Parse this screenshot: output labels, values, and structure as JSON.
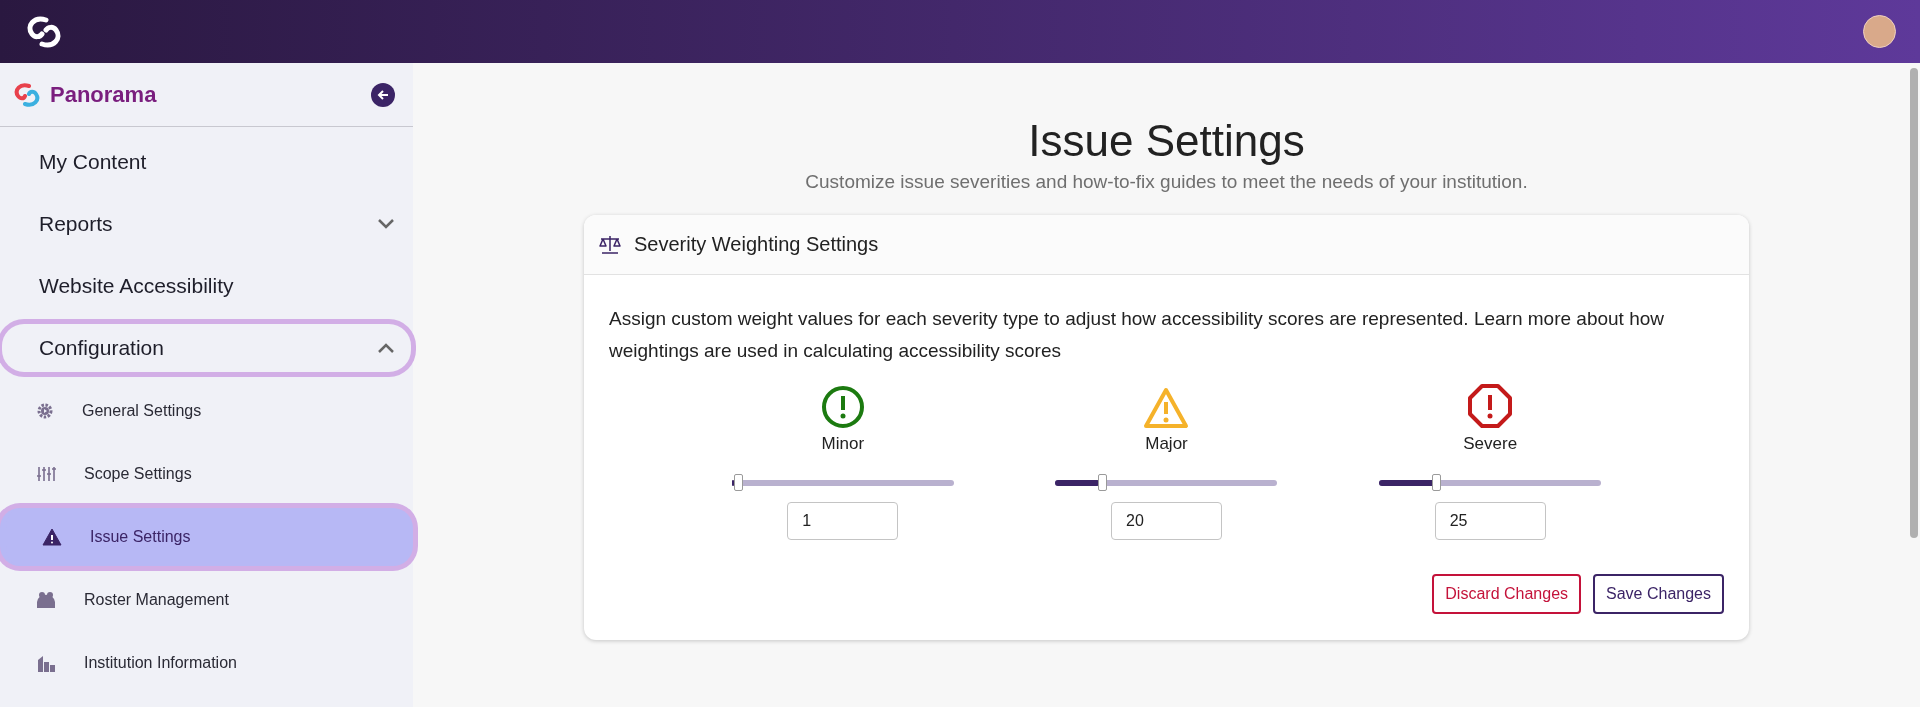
{
  "app": {
    "name": "Panorama"
  },
  "sidebar": {
    "items": [
      {
        "label": "My Content",
        "focused": false
      },
      {
        "label": "Reports",
        "expanded": false,
        "focused": false
      },
      {
        "label": "Website Accessibility",
        "focused": false
      },
      {
        "label": "Configuration",
        "expanded": true,
        "focused": true,
        "children": [
          {
            "label": "General Settings",
            "selected": false
          },
          {
            "label": "Scope Settings",
            "selected": false
          },
          {
            "label": "Issue Settings",
            "selected": true
          },
          {
            "label": "Roster Management",
            "selected": false
          },
          {
            "label": "Institution Information",
            "selected": false
          }
        ]
      }
    ]
  },
  "page": {
    "title": "Issue Settings",
    "subtitle": "Customize issue severities and how-to-fix guides to meet the needs of your institution."
  },
  "card": {
    "title": "Severity Weighting Settings",
    "description": "Assign custom weight values for each severity type to adjust how accessibility scores are represented. Learn more about how weightings are used in calculating accessibility scores",
    "severities": [
      {
        "kind": "minor",
        "label": "Minor",
        "level": 0.01,
        "value": "1"
      },
      {
        "kind": "major",
        "label": "Major",
        "level": 0.2,
        "value": "20"
      },
      {
        "kind": "severe",
        "label": "Severe",
        "level": 0.25,
        "value": "25"
      }
    ],
    "buttons": [
      {
        "kind": "discard",
        "label": "Discard Changes"
      },
      {
        "kind": "save",
        "label": "Save Changes"
      }
    ]
  }
}
